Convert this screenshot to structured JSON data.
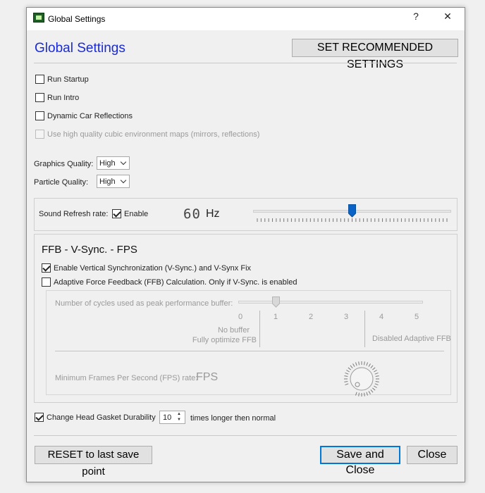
{
  "window": {
    "title": "Global Settings",
    "help_glyph": "?",
    "close_glyph": "✕"
  },
  "header": {
    "title": "Global Settings",
    "recommended_button": "SET RECOMMENDED SETTINGS"
  },
  "options": {
    "run_startup": {
      "label": "Run Startup",
      "checked": false
    },
    "run_intro": {
      "label": "Run Intro",
      "checked": false
    },
    "dynamic_reflections": {
      "label": "Dynamic Car Reflections",
      "checked": false
    },
    "hq_cubic_maps": {
      "label": "Use high quality cubic environment maps (mirrors, reflections)",
      "checked": false,
      "enabled": false
    }
  },
  "quality": {
    "graphics_label": "Graphics Quality:",
    "graphics_value": "High",
    "particle_label": "Particle Quality:",
    "particle_value": "High"
  },
  "sound": {
    "label": "Sound Refresh rate:",
    "enable_label": "Enable",
    "enabled": true,
    "rate_value": "60",
    "rate_unit": "Hz",
    "slider_fraction": 0.5
  },
  "ffb": {
    "title": "FFB - V-Sync. - FPS",
    "vsync_label": "Enable Vertical Synchronization (V-Sync.) and V-Synx Fix",
    "vsync_checked": true,
    "adaptive_label": "Adaptive Force Feedback (FFB)  Calculation.   Only if V-Sync. is enabled",
    "adaptive_checked": false,
    "cycles_label": "Number of cycles used as peak performance buffer:",
    "cycles_ticks": [
      "0",
      "1",
      "2",
      "3",
      "4",
      "5"
    ],
    "cycles_value": 1,
    "no_buffer_line1": "No buffer",
    "no_buffer_line2": "Fully optimize FFB",
    "disabled_label": "Disabled Adaptive FFB",
    "min_fps_label": "Minimum Frames Per Second (FPS) rate:",
    "fps_unit": "FPS"
  },
  "gasket": {
    "label": "Change Head Gasket Durability",
    "checked": true,
    "value": "10",
    "suffix": "times longer then normal"
  },
  "footer": {
    "reset_button": "RESET to last save point",
    "save_button": "Save and Close",
    "close_button": "Close"
  }
}
